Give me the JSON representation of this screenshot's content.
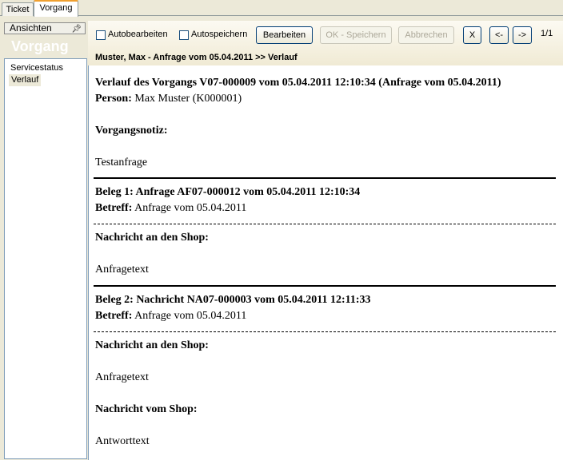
{
  "tabs": [
    {
      "label": "Ticket"
    },
    {
      "label": "Vorgang"
    }
  ],
  "left_panel": {
    "header": "Ansichten",
    "title": "Vorgang",
    "items": [
      {
        "label": "Servicestatus"
      },
      {
        "label": "Verlauf"
      }
    ]
  },
  "toolbar": {
    "autoedit_label": "Autobearbeiten",
    "autosave_label": "Autospeichern",
    "edit_label": "Bearbeiten",
    "ok_save_label": "OK - Speichern",
    "cancel_label": "Abbrechen",
    "close_label": "X",
    "prev_label": "<-",
    "next_label": "->",
    "counter": "1/1"
  },
  "breadcrumb": "Muster, Max - Anfrage vom 05.04.2011 >> Verlauf",
  "content": {
    "heading": "Verlauf des Vorgangs V07-000009 vom 05.04.2011 12:10:34 (Anfrage vom 05.04.2011)",
    "person_label": "Person:",
    "person_value": " Max Muster (K000001)",
    "note_label": "Vorgangsnotiz:",
    "note_text": "Testanfrage",
    "beleg1": {
      "heading": "Beleg 1: Anfrage AF07-000012 vom 05.04.2011 12:10:34",
      "subject_label": "Betreff:",
      "subject_value": " Anfrage vom 05.04.2011",
      "msg_label": "Nachricht an den Shop:",
      "msg_text": "Anfragetext"
    },
    "beleg2": {
      "heading": "Beleg 2: Nachricht NA07-000003 vom 05.04.2011 12:11:33",
      "subject_label": "Betreff:",
      "subject_value": " Anfrage vom 05.04.2011",
      "msg_label": "Nachricht an den Shop:",
      "msg_text": "Anfragetext",
      "reply_label": "Nachricht vom Shop:",
      "reply_text": "Antworttext"
    }
  }
}
